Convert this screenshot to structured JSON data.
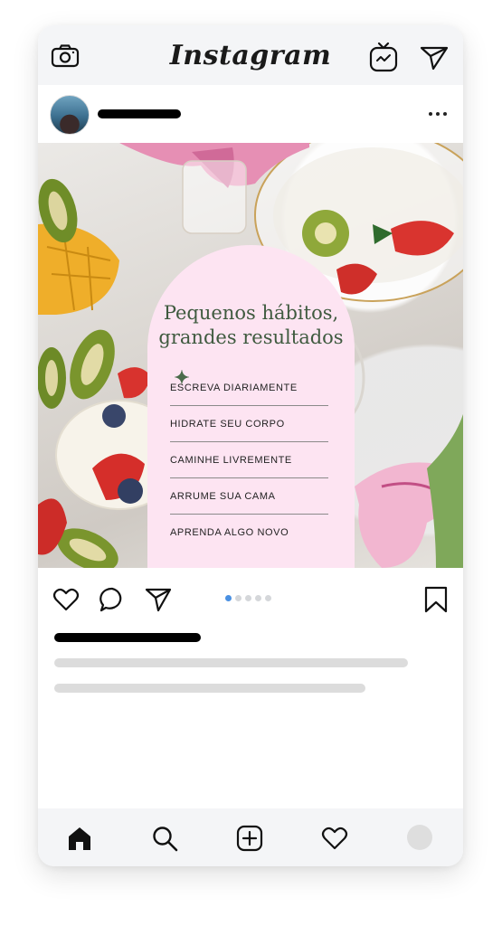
{
  "app": {
    "logo": "Instagram"
  },
  "post": {
    "title_line1": "Pequenos hábitos,",
    "title_line2": "grandes resultados",
    "items": [
      "ESCREVA DIARIAMENTE",
      "HIDRATE SEU CORPO",
      "CAMINHE LIVREMENTE",
      "ARRUME SUA CAMA",
      "APRENDA ALGO NOVO"
    ],
    "carousel": {
      "total": 5,
      "active": 1
    }
  },
  "colors": {
    "title_green": "#3f5a3f",
    "arch_pink": "#fde4f2",
    "active_dot": "#4a90e2"
  },
  "icons": {
    "topbar": [
      "camera-icon",
      "igtv-icon",
      "send-icon"
    ],
    "actions": [
      "heart-icon",
      "comment-icon",
      "share-icon",
      "bookmark-icon"
    ],
    "bottombar": [
      "home-icon",
      "search-icon",
      "add-post-icon",
      "activity-heart-icon",
      "profile-avatar"
    ]
  }
}
